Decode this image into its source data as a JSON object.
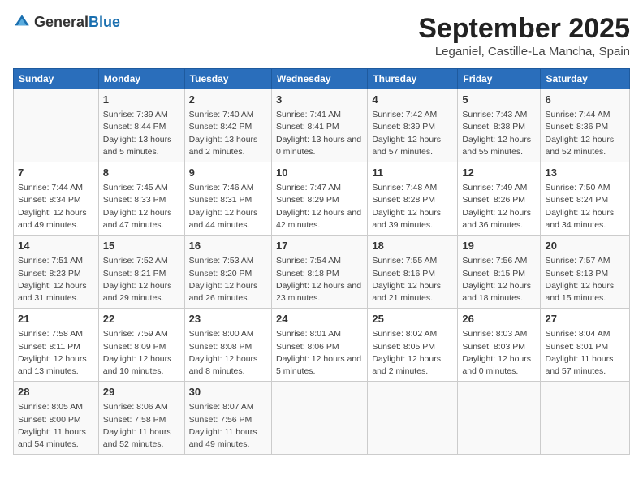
{
  "logo": {
    "general": "General",
    "blue": "Blue"
  },
  "title": "September 2025",
  "location": "Leganiel, Castille-La Mancha, Spain",
  "weekdays": [
    "Sunday",
    "Monday",
    "Tuesday",
    "Wednesday",
    "Thursday",
    "Friday",
    "Saturday"
  ],
  "weeks": [
    [
      {
        "day": null
      },
      {
        "day": "1",
        "sunrise": "7:39 AM",
        "sunset": "8:44 PM",
        "daylight": "13 hours and 5 minutes."
      },
      {
        "day": "2",
        "sunrise": "7:40 AM",
        "sunset": "8:42 PM",
        "daylight": "13 hours and 2 minutes."
      },
      {
        "day": "3",
        "sunrise": "7:41 AM",
        "sunset": "8:41 PM",
        "daylight": "13 hours and 0 minutes."
      },
      {
        "day": "4",
        "sunrise": "7:42 AM",
        "sunset": "8:39 PM",
        "daylight": "12 hours and 57 minutes."
      },
      {
        "day": "5",
        "sunrise": "7:43 AM",
        "sunset": "8:38 PM",
        "daylight": "12 hours and 55 minutes."
      },
      {
        "day": "6",
        "sunrise": "7:44 AM",
        "sunset": "8:36 PM",
        "daylight": "12 hours and 52 minutes."
      }
    ],
    [
      {
        "day": "7",
        "sunrise": "7:44 AM",
        "sunset": "8:34 PM",
        "daylight": "12 hours and 49 minutes."
      },
      {
        "day": "8",
        "sunrise": "7:45 AM",
        "sunset": "8:33 PM",
        "daylight": "12 hours and 47 minutes."
      },
      {
        "day": "9",
        "sunrise": "7:46 AM",
        "sunset": "8:31 PM",
        "daylight": "12 hours and 44 minutes."
      },
      {
        "day": "10",
        "sunrise": "7:47 AM",
        "sunset": "8:29 PM",
        "daylight": "12 hours and 42 minutes."
      },
      {
        "day": "11",
        "sunrise": "7:48 AM",
        "sunset": "8:28 PM",
        "daylight": "12 hours and 39 minutes."
      },
      {
        "day": "12",
        "sunrise": "7:49 AM",
        "sunset": "8:26 PM",
        "daylight": "12 hours and 36 minutes."
      },
      {
        "day": "13",
        "sunrise": "7:50 AM",
        "sunset": "8:24 PM",
        "daylight": "12 hours and 34 minutes."
      }
    ],
    [
      {
        "day": "14",
        "sunrise": "7:51 AM",
        "sunset": "8:23 PM",
        "daylight": "12 hours and 31 minutes."
      },
      {
        "day": "15",
        "sunrise": "7:52 AM",
        "sunset": "8:21 PM",
        "daylight": "12 hours and 29 minutes."
      },
      {
        "day": "16",
        "sunrise": "7:53 AM",
        "sunset": "8:20 PM",
        "daylight": "12 hours and 26 minutes."
      },
      {
        "day": "17",
        "sunrise": "7:54 AM",
        "sunset": "8:18 PM",
        "daylight": "12 hours and 23 minutes."
      },
      {
        "day": "18",
        "sunrise": "7:55 AM",
        "sunset": "8:16 PM",
        "daylight": "12 hours and 21 minutes."
      },
      {
        "day": "19",
        "sunrise": "7:56 AM",
        "sunset": "8:15 PM",
        "daylight": "12 hours and 18 minutes."
      },
      {
        "day": "20",
        "sunrise": "7:57 AM",
        "sunset": "8:13 PM",
        "daylight": "12 hours and 15 minutes."
      }
    ],
    [
      {
        "day": "21",
        "sunrise": "7:58 AM",
        "sunset": "8:11 PM",
        "daylight": "12 hours and 13 minutes."
      },
      {
        "day": "22",
        "sunrise": "7:59 AM",
        "sunset": "8:09 PM",
        "daylight": "12 hours and 10 minutes."
      },
      {
        "day": "23",
        "sunrise": "8:00 AM",
        "sunset": "8:08 PM",
        "daylight": "12 hours and 8 minutes."
      },
      {
        "day": "24",
        "sunrise": "8:01 AM",
        "sunset": "8:06 PM",
        "daylight": "12 hours and 5 minutes."
      },
      {
        "day": "25",
        "sunrise": "8:02 AM",
        "sunset": "8:05 PM",
        "daylight": "12 hours and 2 minutes."
      },
      {
        "day": "26",
        "sunrise": "8:03 AM",
        "sunset": "8:03 PM",
        "daylight": "12 hours and 0 minutes."
      },
      {
        "day": "27",
        "sunrise": "8:04 AM",
        "sunset": "8:01 PM",
        "daylight": "11 hours and 57 minutes."
      }
    ],
    [
      {
        "day": "28",
        "sunrise": "8:05 AM",
        "sunset": "8:00 PM",
        "daylight": "11 hours and 54 minutes."
      },
      {
        "day": "29",
        "sunrise": "8:06 AM",
        "sunset": "7:58 PM",
        "daylight": "11 hours and 52 minutes."
      },
      {
        "day": "30",
        "sunrise": "8:07 AM",
        "sunset": "7:56 PM",
        "daylight": "11 hours and 49 minutes."
      },
      {
        "day": null
      },
      {
        "day": null
      },
      {
        "day": null
      },
      {
        "day": null
      }
    ]
  ]
}
